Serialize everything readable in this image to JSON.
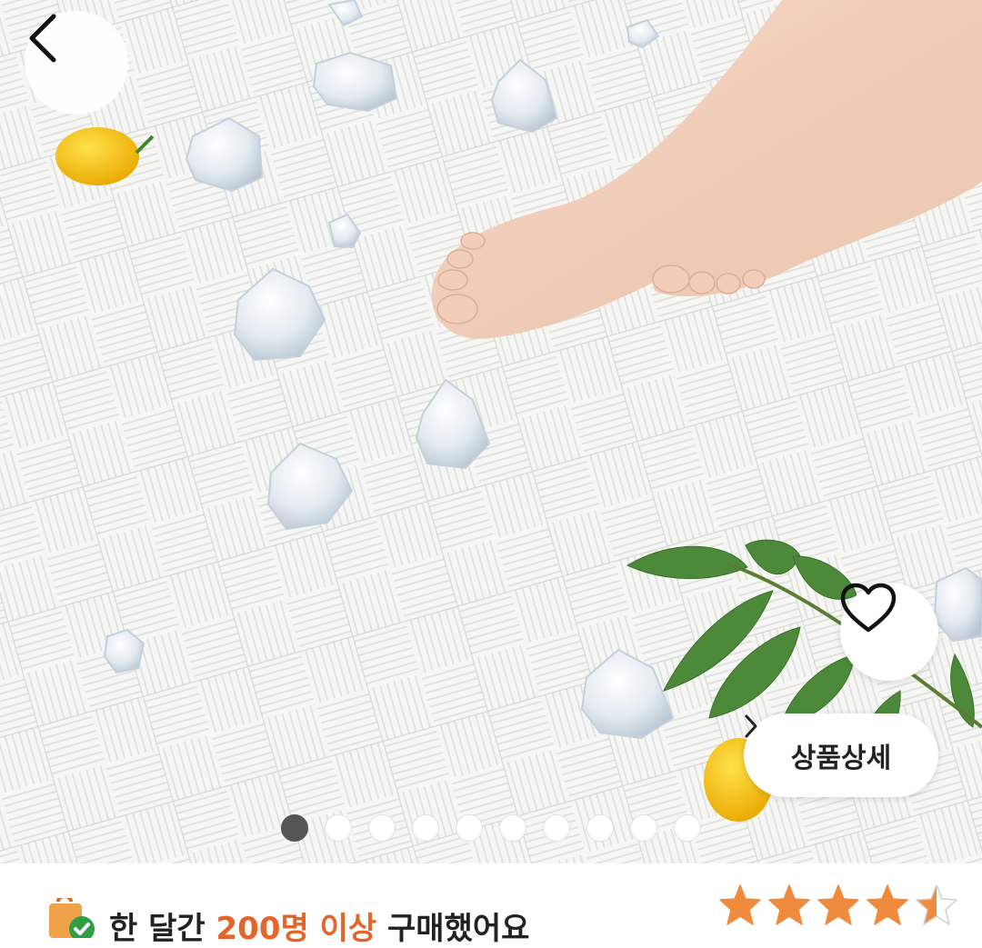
{
  "top_bar": {
    "back_icon": "chevron-left-icon"
  },
  "gallery": {
    "total_images": 10,
    "active_index": 0,
    "actions": {
      "like_icon": "heart-outline-icon",
      "detail_label": "상품상세",
      "detail_icon": "chevron-right-icon"
    }
  },
  "purchase_info": {
    "prefix": "한 달간 ",
    "highlight": "200명 이상",
    "suffix": " 구매했어요",
    "icon": "shopping-bag-check-icon",
    "highlight_color": "#e4642a"
  },
  "rating": {
    "value": 4.5,
    "max": 5,
    "star_color": "#f08a3c",
    "icon": "star-icon"
  }
}
